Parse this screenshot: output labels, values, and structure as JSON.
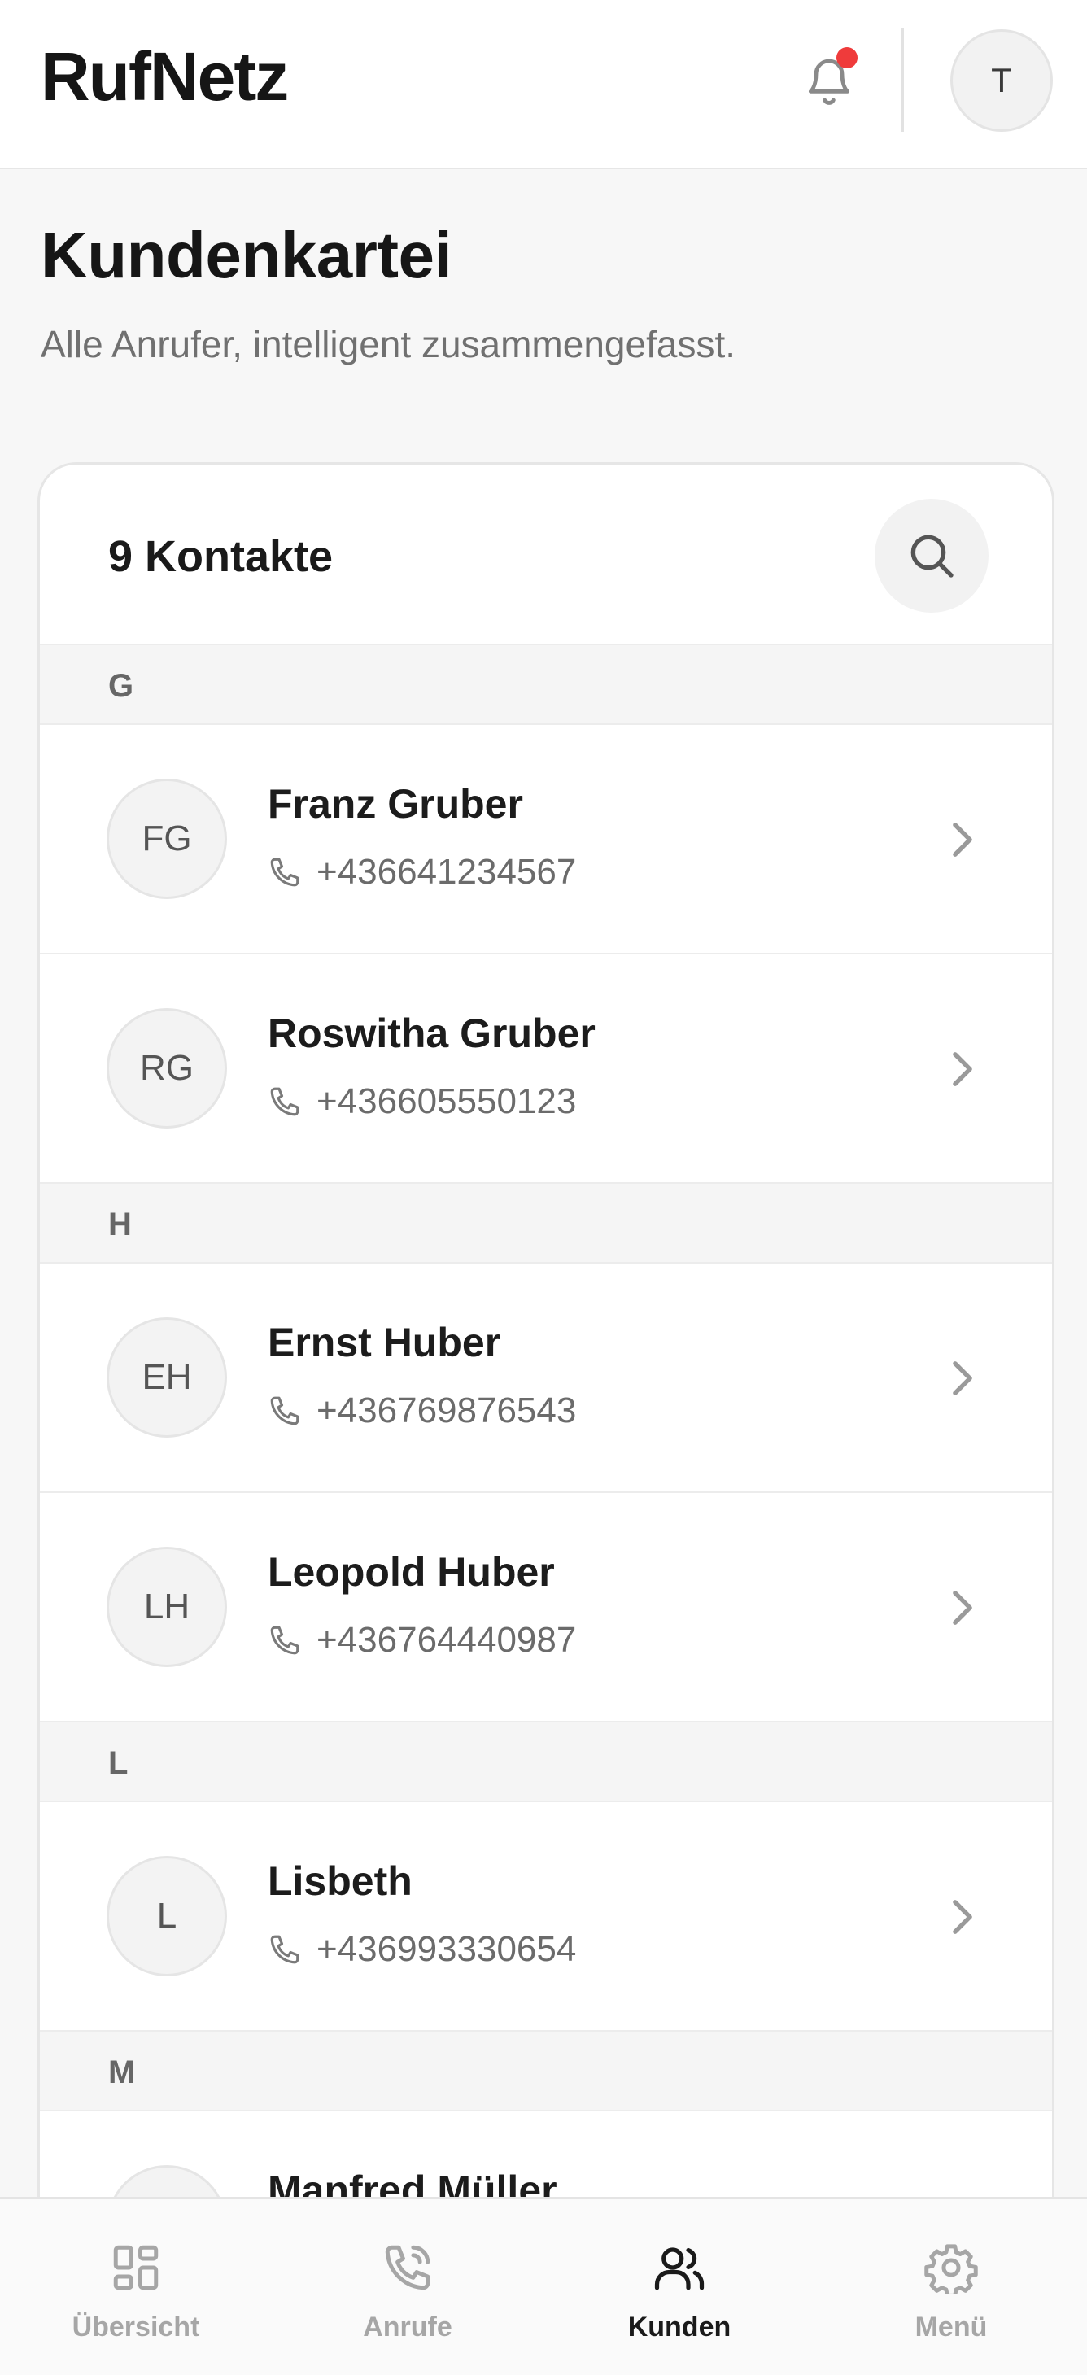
{
  "app": {
    "name": "RufNetz",
    "user_initial": "T",
    "has_unread_notifications": true
  },
  "page": {
    "title": "Kundenkartei",
    "subtitle": "Alle Anrufer, intelligent zusammengefasst."
  },
  "list": {
    "count_label": "9 Kontakte",
    "sections": [
      {
        "letter": "G",
        "contacts": [
          {
            "initials": "FG",
            "name": "Franz Gruber",
            "phone": "+436641234567"
          },
          {
            "initials": "RG",
            "name": "Roswitha Gruber",
            "phone": "+436605550123"
          }
        ]
      },
      {
        "letter": "H",
        "contacts": [
          {
            "initials": "EH",
            "name": "Ernst Huber",
            "phone": "+436769876543"
          },
          {
            "initials": "LH",
            "name": "Leopold Huber",
            "phone": "+436764440987"
          }
        ]
      },
      {
        "letter": "L",
        "contacts": [
          {
            "initials": "L",
            "name": "Lisbeth",
            "phone": "+436993330654"
          }
        ]
      },
      {
        "letter": "M",
        "contacts": [
          {
            "initials": "",
            "name": "Manfred Müller",
            "phone": ""
          }
        ]
      }
    ]
  },
  "tabs": [
    {
      "label": "Übersicht",
      "icon": "grid-icon",
      "active": false
    },
    {
      "label": "Anrufe",
      "icon": "phone-call-icon",
      "active": false
    },
    {
      "label": "Kunden",
      "icon": "users-icon",
      "active": true
    },
    {
      "label": "Menü",
      "icon": "gear-icon",
      "active": false
    }
  ],
  "colors": {
    "notification_dot": "#ef3b3b",
    "active_tab": "#1a1a1a",
    "inactive_tab": "#a6a6a6"
  }
}
